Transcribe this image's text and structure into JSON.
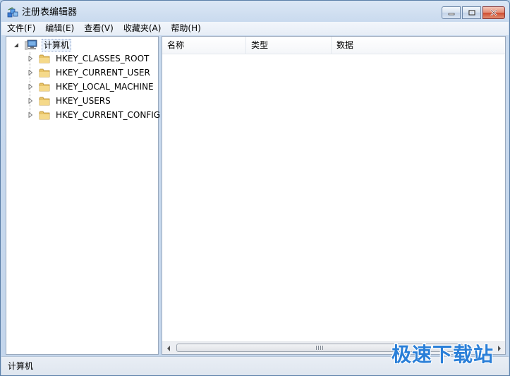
{
  "window": {
    "title": "注册表编辑器"
  },
  "menu": [
    "文件(F)",
    "编辑(E)",
    "查看(V)",
    "收藏夹(A)",
    "帮助(H)"
  ],
  "tree": {
    "root": "计算机",
    "children": [
      "HKEY_CLASSES_ROOT",
      "HKEY_CURRENT_USER",
      "HKEY_LOCAL_MACHINE",
      "HKEY_USERS",
      "HKEY_CURRENT_CONFIG"
    ]
  },
  "columns": [
    "名称",
    "类型",
    "数据"
  ],
  "status": {
    "path": "计算机"
  },
  "watermark": {
    "text": "极速下载站"
  },
  "colors": {
    "watermark": "#2a7fd8",
    "frame": "#c4d6ec"
  }
}
